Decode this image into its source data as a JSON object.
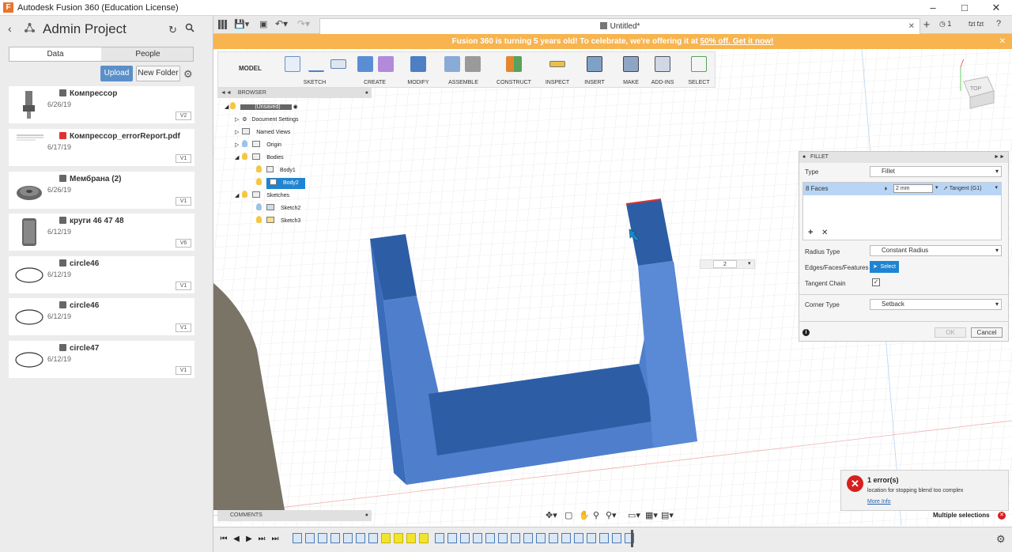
{
  "app": {
    "title": "Autodesk Fusion 360 (Education License)"
  },
  "data_panel": {
    "project_title": "Admin Project",
    "tabs": [
      "Data",
      "People"
    ],
    "upload_label": "Upload",
    "new_folder_label": "New Folder",
    "files": [
      {
        "name": "Компрессор",
        "date": "6/26/19",
        "version": "V2",
        "icon": "component-icon"
      },
      {
        "name": "Компрессор_errorReport.pdf",
        "date": "6/17/19",
        "version": "V1",
        "icon": "pdf-icon"
      },
      {
        "name": "Мембрана (2)",
        "date": "6/26/19",
        "version": "V1",
        "icon": "component-icon"
      },
      {
        "name": "круги 46 47 48",
        "date": "6/12/19",
        "version": "V6",
        "icon": "component-icon"
      },
      {
        "name": "circle46",
        "date": "6/12/19",
        "version": "V1",
        "icon": "component-icon"
      },
      {
        "name": "circle46",
        "date": "6/12/19",
        "version": "V1",
        "icon": "component-icon"
      },
      {
        "name": "circle47",
        "date": "6/12/19",
        "version": "V1",
        "icon": "component-icon"
      }
    ]
  },
  "doc_tab": {
    "label": "Untitled*"
  },
  "user": {
    "jobs_count": "1",
    "name": "fzt fzt"
  },
  "banner": {
    "text": "Fusion 360 is turning 5 years old! To celebrate, we're offering it at ",
    "link": "50% off. Get it now!"
  },
  "toolbar": {
    "workspace": "MODEL",
    "groups": [
      "SKETCH",
      "CREATE",
      "MODIFY",
      "ASSEMBLE",
      "CONSTRUCT",
      "INSPECT",
      "INSERT",
      "MAKE",
      "ADD-INS",
      "SELECT"
    ]
  },
  "browser": {
    "title": "BROWSER",
    "root": "(Unsaved)",
    "items": [
      {
        "label": "Document Settings"
      },
      {
        "label": "Named Views"
      },
      {
        "label": "Origin"
      },
      {
        "label": "Bodies"
      },
      {
        "label": "Body1"
      },
      {
        "label": "Body2"
      },
      {
        "label": "Sketches"
      },
      {
        "label": "Sketch2"
      },
      {
        "label": "Sketch3"
      }
    ]
  },
  "viewcube": {
    "face": "TOP"
  },
  "measure_input": {
    "value": "2"
  },
  "fillet": {
    "title": "FILLET",
    "type_label": "Type",
    "type_value": "Fillet",
    "selection_label": "8 Faces",
    "radius_value": "2 mm",
    "continuity": "Tangent (G1)",
    "radius_type_label": "Radius Type",
    "radius_type_value": "Constant Radius",
    "edges_label": "Edges/Faces/Features",
    "select_button": "Select",
    "tangent_chain_label": "Tangent Chain",
    "corner_type_label": "Corner Type",
    "corner_type_value": "Setback",
    "ok_label": "OK",
    "cancel_label": "Cancel"
  },
  "comments": {
    "label": "COMMENTS"
  },
  "error": {
    "title": "1 error(s)",
    "message": "location for stopping blend too complex",
    "link": "More Info"
  },
  "status": {
    "multiple_selections": "Multiple selections"
  },
  "colors": {
    "accent": "#f7b44f",
    "body_blue": "#4f7fcc",
    "body_dark": "#2d5ea5",
    "error_red": "#d71f1f",
    "select_blue": "#1f84d1"
  }
}
